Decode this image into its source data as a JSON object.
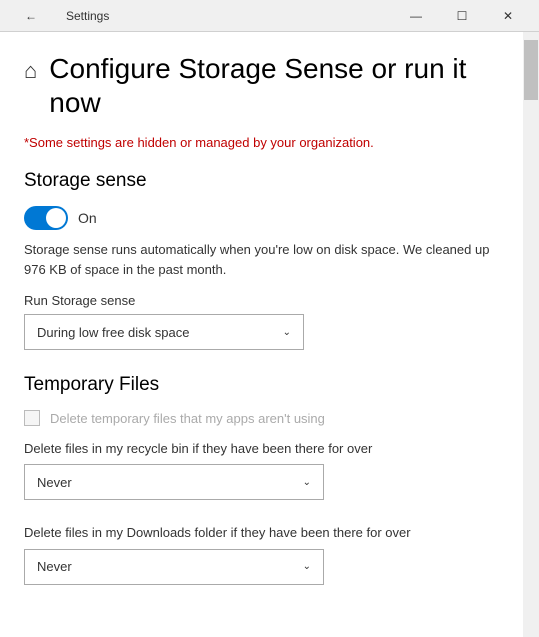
{
  "titleBar": {
    "back_icon": "←",
    "title": "Settings",
    "minimize_icon": "—",
    "maximize_icon": "☐",
    "close_icon": "✕"
  },
  "page": {
    "home_icon": "⌂",
    "title": "Configure Storage Sense or run it now",
    "warning": "*Some settings are hidden or managed by your organization."
  },
  "storageSense": {
    "section_title": "Storage sense",
    "toggle_label": "On",
    "description": "Storage sense runs automatically when you're low on disk space. We cleaned up 976 KB of space in the past month.",
    "run_label": "Run Storage sense",
    "dropdown_value": "During low free disk space"
  },
  "temporaryFiles": {
    "section_title": "Temporary Files",
    "checkbox_label": "Delete temporary files that my apps aren't using",
    "recycle_label": "Delete files in my recycle bin if they have been there for over",
    "recycle_value": "Never",
    "downloads_label": "Delete files in my Downloads folder if they have been there for over",
    "downloads_value": "Never"
  }
}
